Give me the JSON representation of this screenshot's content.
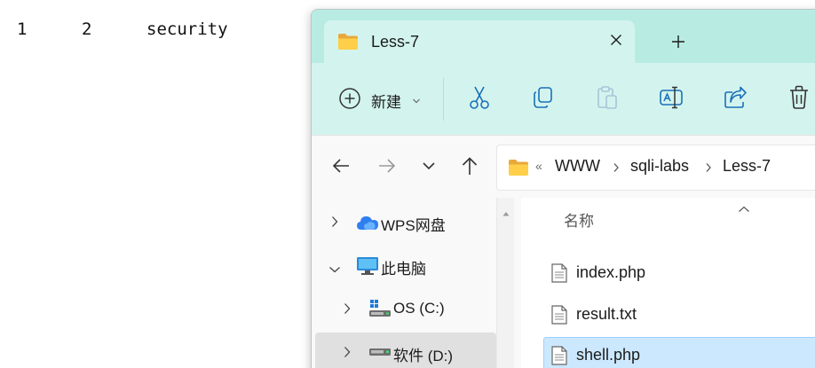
{
  "background": {
    "output_row": [
      "1",
      "2",
      "security"
    ]
  },
  "explorer": {
    "tab": {
      "title": "Less-7",
      "close_icon": "close-icon",
      "new_tab_icon": "plus-icon"
    },
    "toolbar": {
      "new_label": "新建",
      "buttons": [
        "cut-icon",
        "copy-icon",
        "paste-icon",
        "rename-icon",
        "share-icon",
        "delete-icon"
      ]
    },
    "address": {
      "overflow": "«",
      "breadcrumbs": [
        "WWW",
        "sqli-labs",
        "Less-7"
      ]
    },
    "sidebar": {
      "items": [
        {
          "label": "WPS网盘",
          "icon": "cloud-icon",
          "expanded": false
        },
        {
          "label": "此电脑",
          "icon": "computer-icon",
          "expanded": true
        },
        {
          "label": "OS (C:)",
          "icon": "windows-drive-icon",
          "expanded": false
        },
        {
          "label": "软件 (D:)",
          "icon": "drive-icon",
          "expanded": false,
          "selected": true
        }
      ]
    },
    "content": {
      "column_name": "名称",
      "files": [
        {
          "name": "index.php",
          "selected": false
        },
        {
          "name": "result.txt",
          "selected": false
        },
        {
          "name": "shell.php",
          "selected": true
        }
      ]
    },
    "colors": {
      "tabbar": "#b8ece3",
      "toolbar": "#d3f4ee",
      "selection": "#cce8ff",
      "accent": "#0067c0"
    }
  }
}
